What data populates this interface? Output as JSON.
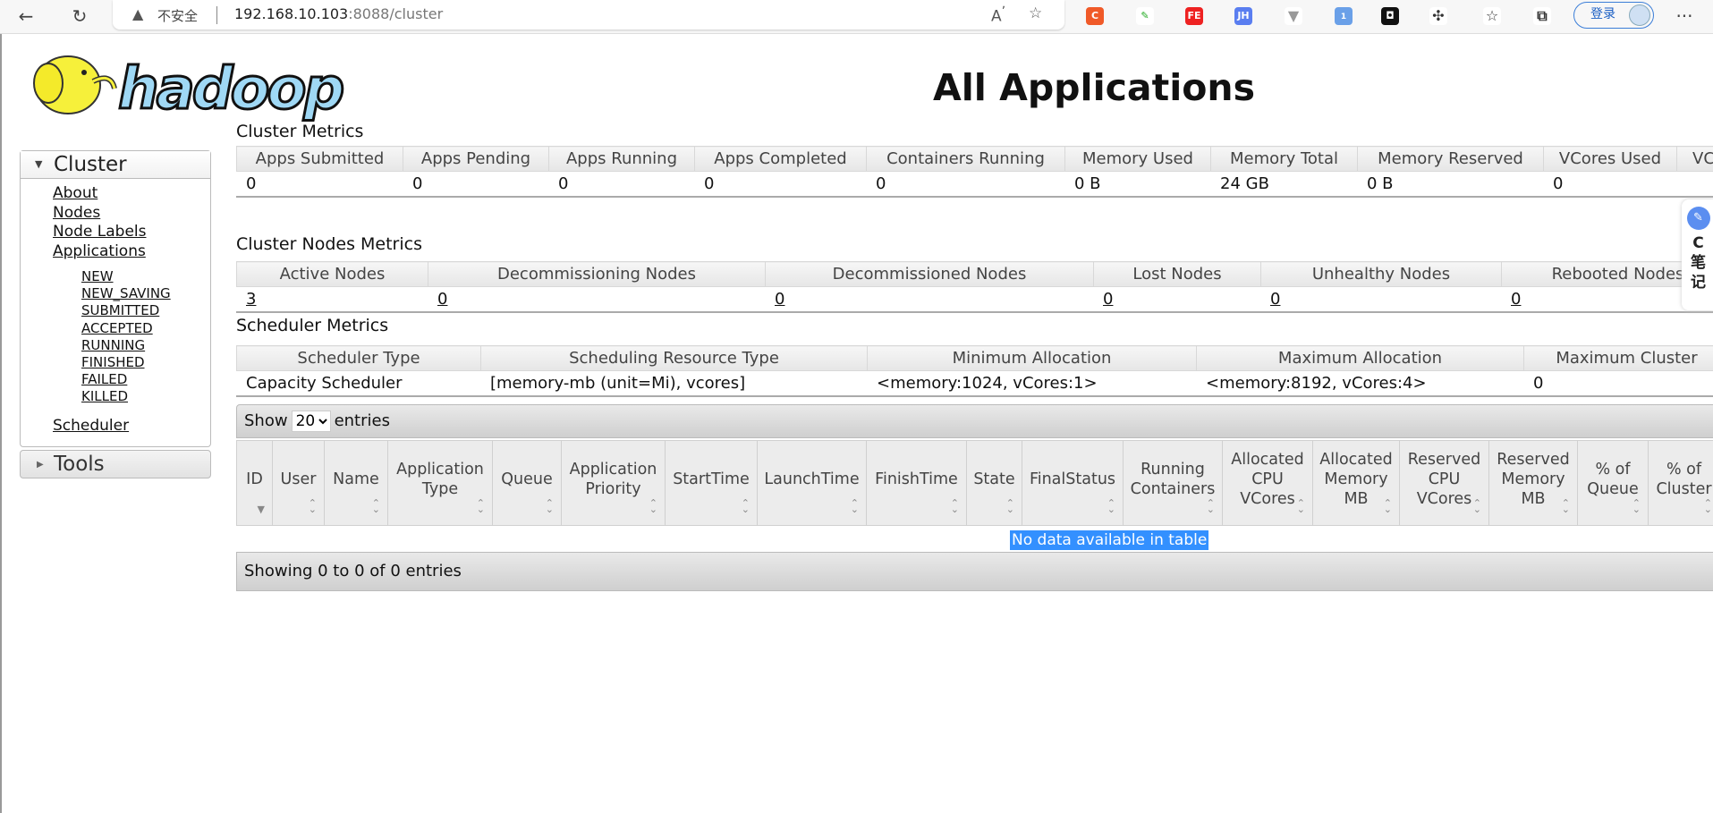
{
  "browser": {
    "insecure_label": "不安全",
    "url_host": "192.168.10.103",
    "url_rest": ":8088/cluster",
    "login_label": "登录",
    "ext_badge": "1"
  },
  "logo_text": "hadoop",
  "title": "All Applications",
  "sidebar": {
    "cluster_label": "Cluster",
    "links": [
      "About",
      "Nodes",
      "Node Labels",
      "Applications"
    ],
    "states": [
      "NEW",
      "NEW_SAVING",
      "SUBMITTED",
      "ACCEPTED",
      "RUNNING",
      "FINISHED",
      "FAILED",
      "KILLED"
    ],
    "scheduler_label": "Scheduler",
    "tools_label": "Tools"
  },
  "cluster_metrics": {
    "title": "Cluster Metrics",
    "headers": [
      "Apps Submitted",
      "Apps Pending",
      "Apps Running",
      "Apps Completed",
      "Containers Running",
      "Memory Used",
      "Memory Total",
      "Memory Reserved",
      "VCores Used",
      "VC"
    ],
    "values": [
      "0",
      "0",
      "0",
      "0",
      "0",
      "0 B",
      "24 GB",
      "0 B",
      "0",
      ""
    ]
  },
  "nodes_metrics": {
    "title": "Cluster Nodes Metrics",
    "headers": [
      "Active Nodes",
      "Decommissioning Nodes",
      "Decommissioned Nodes",
      "Lost Nodes",
      "Unhealthy Nodes",
      "Rebooted Nodes"
    ],
    "values": [
      "3",
      "0",
      "0",
      "0",
      "0",
      "0"
    ]
  },
  "scheduler_metrics": {
    "title": "Scheduler Metrics",
    "headers": [
      "Scheduler Type",
      "Scheduling Resource Type",
      "Minimum Allocation",
      "Maximum Allocation",
      "Maximum Cluster"
    ],
    "values": [
      "Capacity Scheduler",
      "[memory-mb (unit=Mi), vcores]",
      "<memory:1024, vCores:1>",
      "<memory:8192, vCores:4>",
      "0"
    ]
  },
  "apps_table": {
    "show_label": "Show",
    "entries_label": "entries",
    "page_size": "20",
    "headers": [
      "ID",
      "User",
      "Name",
      "Application Type",
      "Queue",
      "Application Priority",
      "StartTime",
      "LaunchTime",
      "FinishTime",
      "State",
      "FinalStatus",
      "Running Containers",
      "Allocated CPU VCores",
      "Allocated Memory MB",
      "Reserved CPU VCores",
      "Reserved Memory MB",
      "% of Queue",
      "% of Cluster"
    ],
    "empty_message": "No data available in table",
    "footer": "Showing 0 to 0 of 0 entries"
  },
  "note_widget": {
    "line1": "C",
    "line2": "笔",
    "line3": "记"
  }
}
